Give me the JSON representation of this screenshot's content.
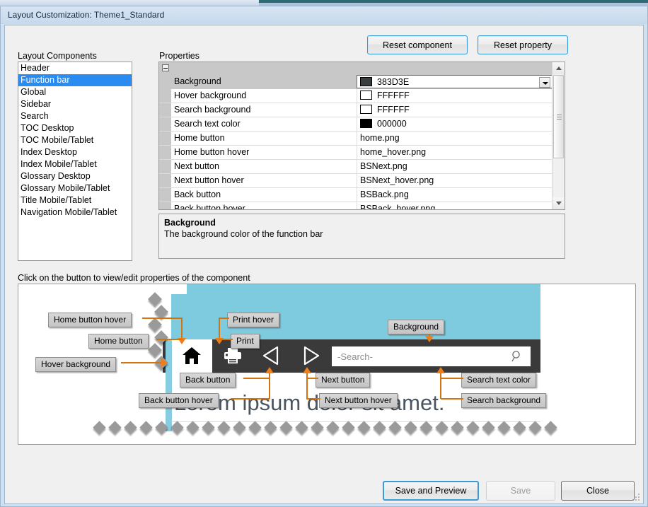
{
  "window": {
    "title": "Layout Customization: Theme1_Standard"
  },
  "sections": {
    "layout_components_label": "Layout Components",
    "properties_label": "Properties",
    "instruction": "Click on the button to view/edit properties of the component"
  },
  "toolbar": {
    "reset_component": "Reset component",
    "reset_property": "Reset property"
  },
  "components": {
    "items": [
      {
        "label": "Header",
        "selected": false
      },
      {
        "label": "Function bar",
        "selected": true
      },
      {
        "label": "Global",
        "selected": false
      },
      {
        "label": "Sidebar",
        "selected": false
      },
      {
        "label": "Search",
        "selected": false
      },
      {
        "label": "TOC Desktop",
        "selected": false
      },
      {
        "label": "TOC Mobile/Tablet",
        "selected": false
      },
      {
        "label": "Index Desktop",
        "selected": false
      },
      {
        "label": "Index Mobile/Tablet",
        "selected": false
      },
      {
        "label": "Glossary Desktop",
        "selected": false
      },
      {
        "label": "Glossary Mobile/Tablet",
        "selected": false
      },
      {
        "label": "Title Mobile/Tablet",
        "selected": false
      },
      {
        "label": "Navigation Mobile/Tablet",
        "selected": false
      }
    ]
  },
  "properties": {
    "rows": [
      {
        "name": "Background",
        "value": "383D3E",
        "swatch": "#383D3E",
        "has_swatch": true,
        "selected": true,
        "has_dropdown": true
      },
      {
        "name": "Hover background",
        "value": "FFFFFF",
        "swatch": "#FFFFFF",
        "has_swatch": true,
        "selected": false,
        "has_dropdown": false
      },
      {
        "name": "Search background",
        "value": "FFFFFF",
        "swatch": "#FFFFFF",
        "has_swatch": true,
        "selected": false,
        "has_dropdown": false
      },
      {
        "name": "Search text color",
        "value": "000000",
        "swatch": "#000000",
        "has_swatch": true,
        "selected": false,
        "has_dropdown": false
      },
      {
        "name": "Home button",
        "value": "home.png",
        "swatch": "",
        "has_swatch": false,
        "selected": false,
        "has_dropdown": false
      },
      {
        "name": "Home button hover",
        "value": "home_hover.png",
        "swatch": "",
        "has_swatch": false,
        "selected": false,
        "has_dropdown": false
      },
      {
        "name": "Next button",
        "value": "BSNext.png",
        "swatch": "",
        "has_swatch": false,
        "selected": false,
        "has_dropdown": false
      },
      {
        "name": "Next button hover",
        "value": "BSNext_hover.png",
        "swatch": "",
        "has_swatch": false,
        "selected": false,
        "has_dropdown": false
      },
      {
        "name": "Back button",
        "value": "BSBack.png",
        "swatch": "",
        "has_swatch": false,
        "selected": false,
        "has_dropdown": false
      },
      {
        "name": "Back button hover",
        "value": "BSBack_hover.png",
        "swatch": "",
        "has_swatch": false,
        "selected": false,
        "has_dropdown": false
      }
    ]
  },
  "description": {
    "title": "Background",
    "text": "The background color of the function bar"
  },
  "preview": {
    "search_placeholder": "-Search-",
    "lorem_text": "Lorem ipsum dolor sit amet.",
    "colors": {
      "teal": "#7ecbe0",
      "function_bar": "#3a3a3a",
      "hover_background": "#FFFFFF",
      "accent_arrow": "#f07d16"
    },
    "callouts": [
      {
        "label": "Home button hover"
      },
      {
        "label": "Home button"
      },
      {
        "label": "Hover background"
      },
      {
        "label": "Print hover"
      },
      {
        "label": "Print"
      },
      {
        "label": "Background"
      },
      {
        "label": "Back button"
      },
      {
        "label": "Back button hover"
      },
      {
        "label": "Next button"
      },
      {
        "label": "Next button hover"
      },
      {
        "label": "Search text color"
      },
      {
        "label": "Search background"
      }
    ]
  },
  "footer": {
    "save_and_preview": "Save and Preview",
    "save": "Save",
    "close": "Close"
  }
}
